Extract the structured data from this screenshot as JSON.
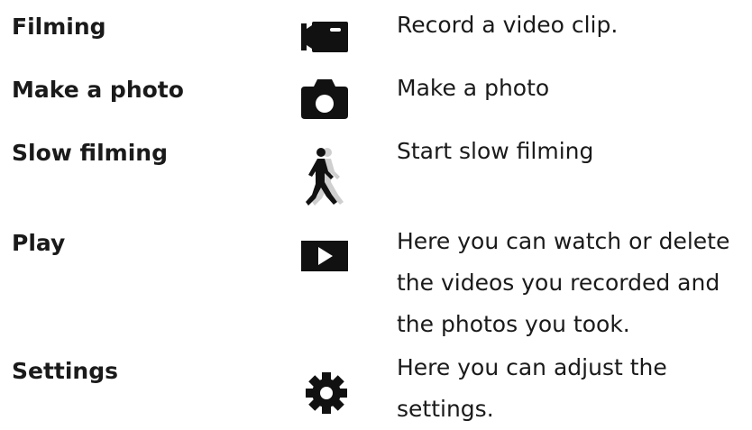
{
  "rows": [
    {
      "label": "Filming",
      "icon": "video-camera-icon",
      "desc_lines": [
        "Record a video clip."
      ]
    },
    {
      "label": "Make a photo",
      "icon": "camera-icon",
      "desc_lines": [
        "Make a photo"
      ]
    },
    {
      "label": "Slow filming",
      "icon": "walking-person-icon",
      "desc_lines": [
        "Start slow filming"
      ]
    },
    {
      "label": "Play",
      "icon": "play-icon",
      "desc_lines": [
        "Here you can watch or delete",
        "the videos you recorded and",
        "the photos you took."
      ]
    },
    {
      "label": "Settings",
      "icon": "gear-icon",
      "desc_lines": [
        "Here you can adjust the",
        "settings."
      ]
    }
  ],
  "colors": {
    "icon": "#111111",
    "icon_shadow": "#cfcfcf",
    "text": "#1a1a1a"
  }
}
